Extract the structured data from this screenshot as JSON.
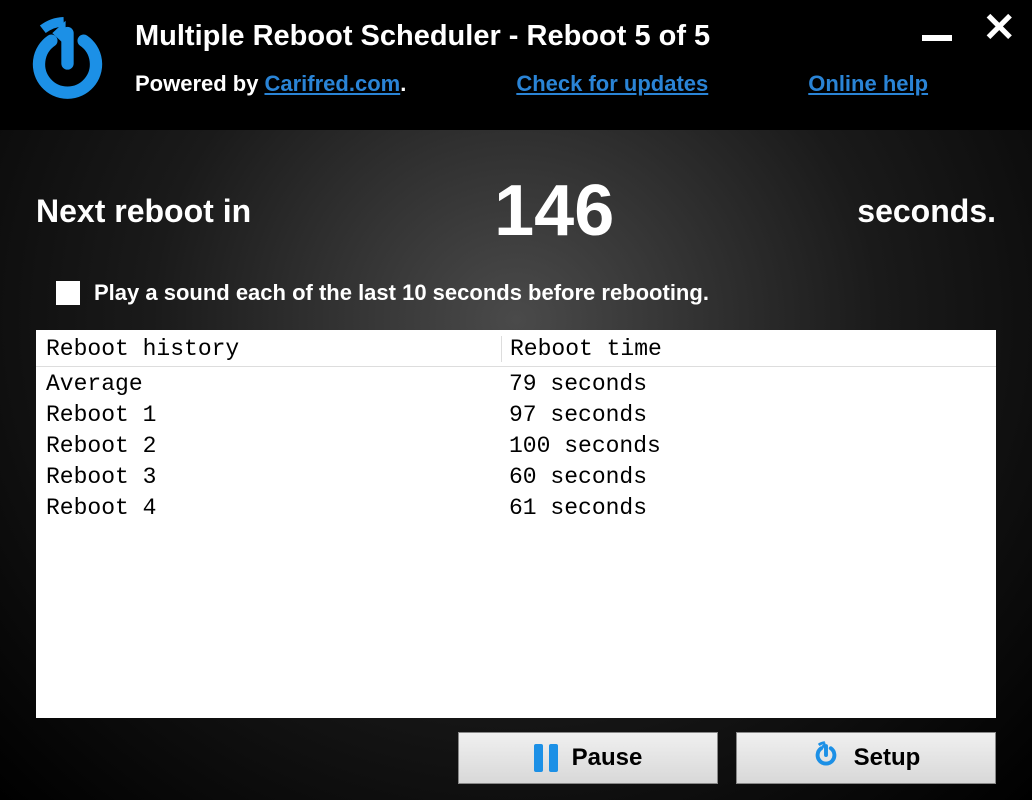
{
  "title": "Multiple Reboot Scheduler - Reboot 5 of 5",
  "powered": {
    "prefix": "Powered by ",
    "site": "Carifred.com",
    "suffix": "."
  },
  "links": {
    "check_updates": "Check for updates",
    "online_help": "Online help"
  },
  "countdown": {
    "label": "Next reboot in",
    "value": "146",
    "suffix": "seconds."
  },
  "sound_option": {
    "checked": false,
    "label": "Play a sound each of the last 10 seconds before rebooting."
  },
  "history": {
    "headers": {
      "col1": "Reboot history",
      "col2": "Reboot time"
    },
    "rows": [
      {
        "name": "Average",
        "time": "79 seconds"
      },
      {
        "name": "Reboot 1",
        "time": "97 seconds"
      },
      {
        "name": "Reboot 2",
        "time": "100 seconds"
      },
      {
        "name": "Reboot 3",
        "time": "60 seconds"
      },
      {
        "name": "Reboot 4",
        "time": "61 seconds"
      }
    ]
  },
  "buttons": {
    "pause": "Pause",
    "setup": "Setup"
  },
  "colors": {
    "accent": "#1c90e6"
  }
}
